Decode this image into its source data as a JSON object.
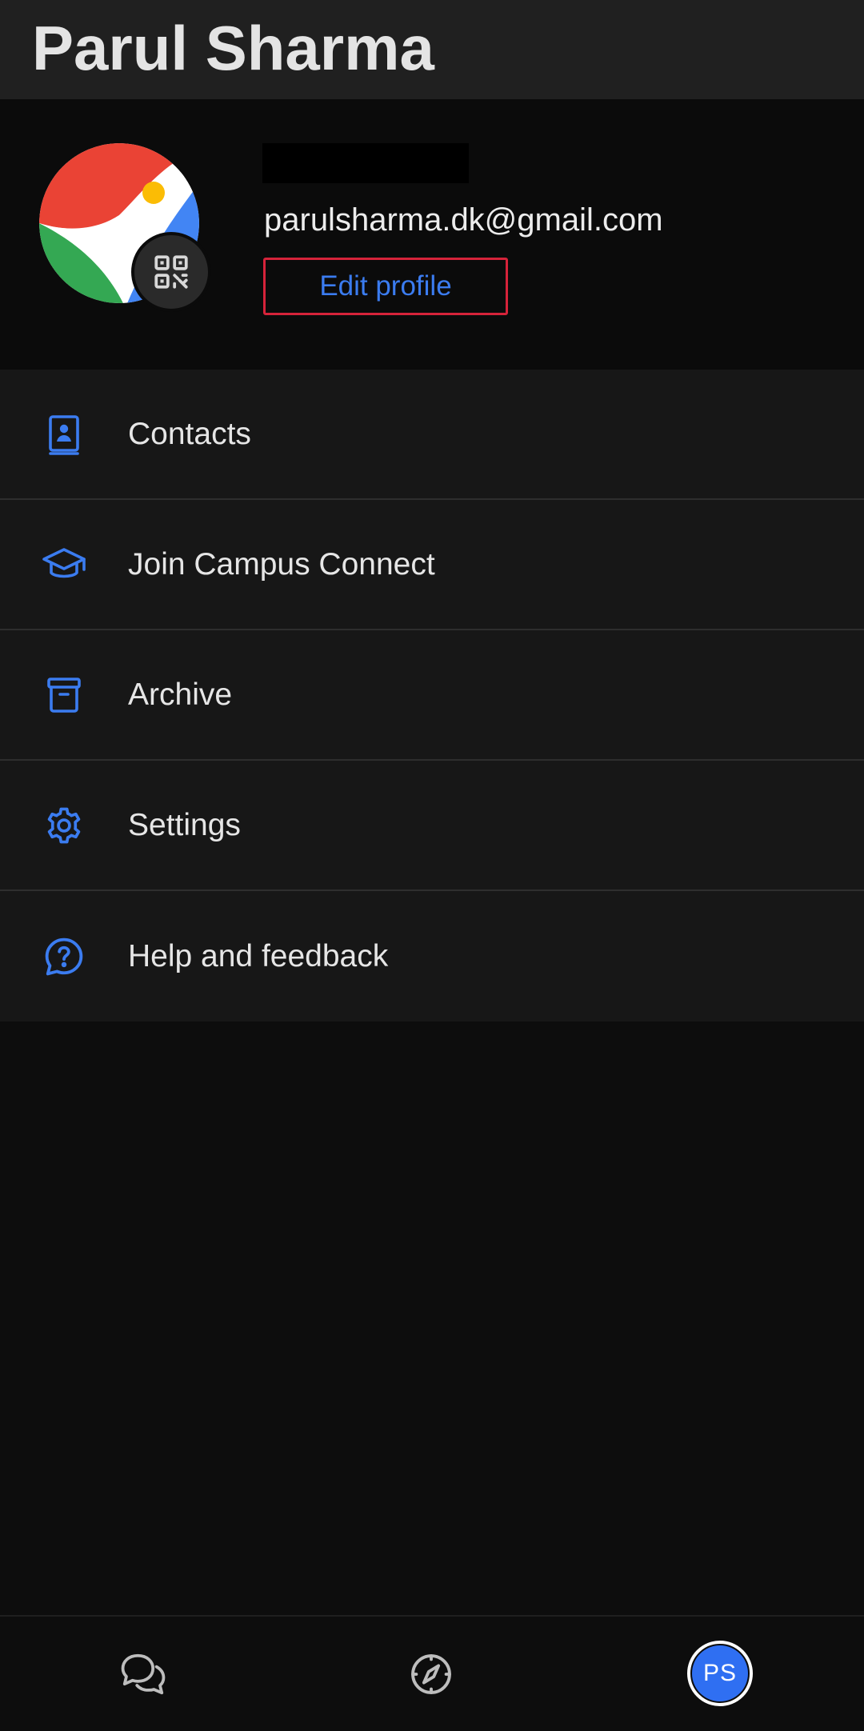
{
  "header": {
    "title": "Parul Sharma"
  },
  "profile": {
    "email": "parulsharma.dk@gmail.com",
    "edit_profile_label": "Edit profile",
    "avatar_icon": "profile-avatar",
    "qr_icon": "qr-code-icon"
  },
  "menu": {
    "items": [
      {
        "label": "Contacts",
        "icon": "contacts-icon"
      },
      {
        "label": "Join Campus Connect",
        "icon": "graduation-cap-icon"
      },
      {
        "label": "Archive",
        "icon": "archive-icon"
      },
      {
        "label": "Settings",
        "icon": "gear-icon"
      },
      {
        "label": "Help and feedback",
        "icon": "help-icon"
      }
    ]
  },
  "bottom_nav": {
    "items": [
      {
        "icon": "chat-icon"
      },
      {
        "icon": "compass-icon"
      }
    ],
    "avatar_initials": "PS"
  },
  "colors": {
    "accent": "#3b7cf0",
    "highlight_border": "#d6233a",
    "background": "#0d0d0d",
    "menu_background": "#171717",
    "header_background": "#202020"
  }
}
